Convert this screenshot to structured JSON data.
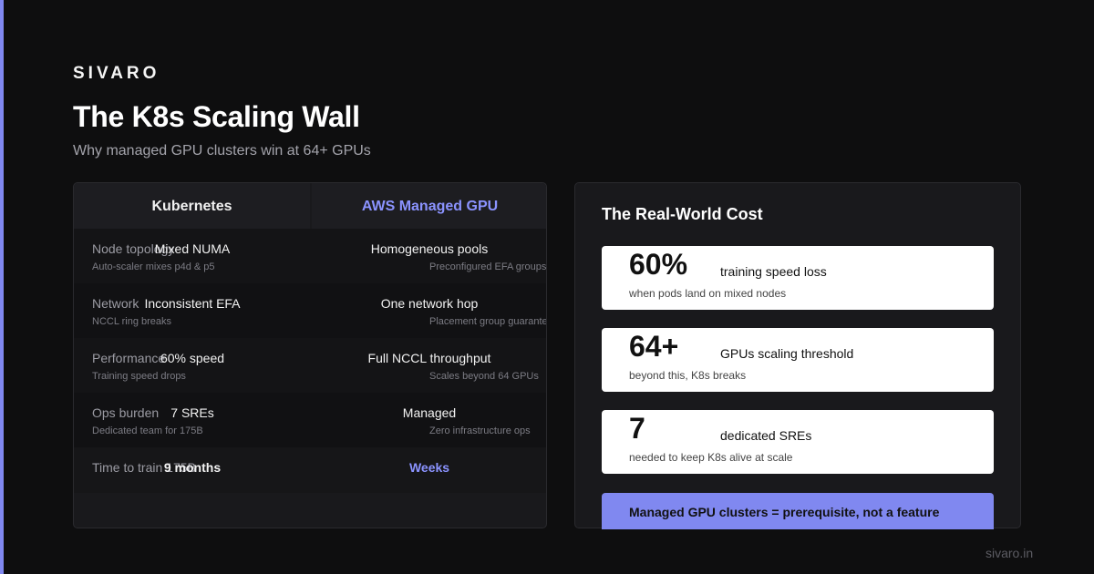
{
  "brand": "SIVARO",
  "title": "The K8s Scaling Wall",
  "subtitle": "Why managed GPU clusters win at 64+ GPUs",
  "table": {
    "headers": {
      "k8s": "Kubernetes",
      "aws": "AWS Managed GPU"
    },
    "rows": [
      {
        "label": "Node topology",
        "k8s": "Mixed NUMA",
        "k8s_sub": "Auto-scaler mixes p4d & p5",
        "aws": "Homogeneous pools",
        "aws_sub": "Preconfigured EFA groups"
      },
      {
        "label": "Network",
        "k8s": "Inconsistent EFA",
        "k8s_sub": "NCCL ring breaks",
        "aws": "One network hop",
        "aws_sub": "Placement group guaranteed"
      },
      {
        "label": "Performance",
        "k8s": "60% speed",
        "k8s_sub": "Training speed drops",
        "aws": "Full NCCL throughput",
        "aws_sub": "Scales beyond 64 GPUs"
      },
      {
        "label": "Ops burden",
        "k8s": "7 SREs",
        "k8s_sub": "Dedicated team for 175B",
        "aws": "Managed",
        "aws_sub": "Zero infrastructure ops"
      },
      {
        "label": "Time to train 175B",
        "k8s": "9 months",
        "k8s_sub": "",
        "aws": "Weeks",
        "aws_sub": ""
      }
    ]
  },
  "cost": {
    "title": "The Real-World Cost",
    "stats": [
      {
        "value": "60%",
        "label": "training speed loss",
        "sub": "when pods land on mixed nodes"
      },
      {
        "value": "64+",
        "label": "GPUs scaling threshold",
        "sub": "beyond this, K8s breaks"
      },
      {
        "value": "7",
        "label": "dedicated SREs",
        "sub": "needed to keep K8s alive at scale"
      }
    ],
    "cta": "Managed GPU clusters = prerequisite, not a feature"
  },
  "footer": "sivaro.in",
  "colors": {
    "accent": "#8088f0",
    "background": "#0e0e0f",
    "card": "#19191c"
  }
}
